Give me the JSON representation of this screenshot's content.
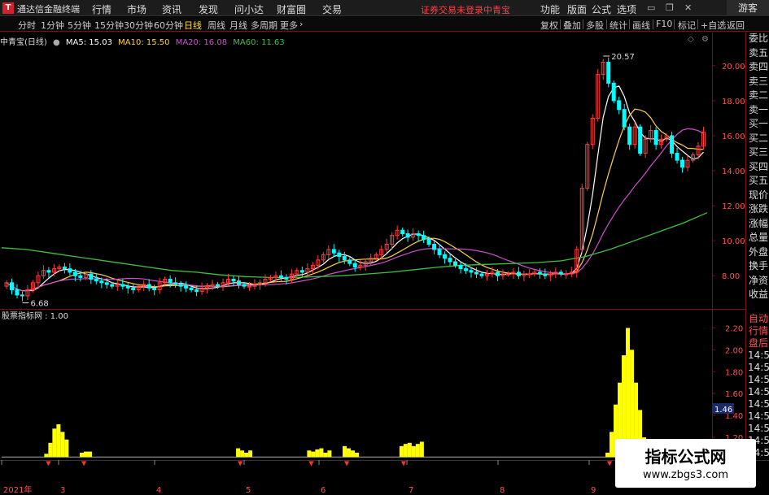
{
  "app": {
    "logo": "T",
    "title": "通达信金融终端"
  },
  "menu": [
    "行情",
    "市场",
    "资讯",
    "发现",
    "问小达",
    "财富圈",
    "交易"
  ],
  "notice": {
    "status": "证券交易未登录",
    "stock": "中青宝"
  },
  "right_menu": [
    "功能",
    "版面",
    "公式",
    "选项"
  ],
  "guest": "游客",
  "periods": [
    {
      "label": "分时",
      "active": false
    },
    {
      "label": "1分钟",
      "active": false
    },
    {
      "label": "5分钟",
      "active": false
    },
    {
      "label": "15分钟",
      "active": false
    },
    {
      "label": "30分钟",
      "active": false
    },
    {
      "label": "60分钟",
      "active": false
    },
    {
      "label": "日线",
      "active": true
    },
    {
      "label": "周线",
      "active": false
    },
    {
      "label": "月线",
      "active": false
    },
    {
      "label": "多周期",
      "active": false
    },
    {
      "label": "更多",
      "active": false
    }
  ],
  "tools": [
    "复权",
    "叠加",
    "多股",
    "统计",
    "画线",
    "F10",
    "标记",
    "+自选",
    "返回"
  ],
  "legend": {
    "stock": "中青宝(日线)",
    "ma": [
      {
        "label": "MA5: 15.03",
        "color": "#ffffff"
      },
      {
        "label": "MA10: 15.50",
        "color": "#ffd24a"
      },
      {
        "label": "MA20: 16.08",
        "color": "#d050d0"
      },
      {
        "label": "MA60: 11.63",
        "color": "#40c040"
      }
    ]
  },
  "sub_legend": "股票指标网 : 1.00",
  "right_panel_top": [
    "委比",
    "卖五",
    "卖四",
    "卖三",
    "卖二",
    "卖一",
    "买一",
    "买二",
    "买三",
    "买四",
    "买五",
    "现价",
    "涨跌",
    "涨幅",
    "总量",
    "外盘",
    "换手",
    "净资",
    "收益"
  ],
  "right_panel_bottom": [
    "自动",
    "行情",
    "盘后",
    "14:56",
    "14:56",
    "14:56",
    "14:56",
    "14:56",
    "14:56",
    "14:56",
    "14:56",
    "14:56"
  ],
  "watermark": {
    "line1": "指标公式网",
    "line2": "www.zbgs3.com"
  },
  "colors": {
    "up": "#ff3c3c",
    "down": "#00ffff",
    "indicator": "#ffff00",
    "grid": "#7a1010"
  },
  "chart_data": [
    {
      "type": "candlestick",
      "title": "中青宝(日线)",
      "y_axis_ticks": [
        "20.00",
        "18.00",
        "16.00",
        "14.00",
        "12.00",
        "10.00",
        "8.00"
      ],
      "ylim": [
        6.2,
        21.2
      ],
      "annotations": [
        {
          "label": "20.57",
          "note": "period high"
        },
        {
          "label": "6.68",
          "note": "period low"
        }
      ],
      "x_ticks": [
        "2021年",
        "3",
        "4",
        "5",
        "6",
        "7",
        "8",
        "9"
      ],
      "close_series": [
        7.6,
        7.2,
        6.9,
        6.85,
        7.2,
        7.6,
        8.0,
        8.3,
        8.2,
        8.4,
        8.5,
        8.4,
        8.2,
        8.0,
        7.9,
        8.1,
        7.8,
        7.7,
        7.6,
        7.5,
        7.4,
        7.5,
        7.4,
        7.3,
        7.2,
        7.4,
        7.5,
        7.3,
        7.2,
        7.6,
        7.8,
        7.6,
        7.5,
        7.4,
        7.3,
        7.2,
        7.1,
        7.3,
        7.4,
        7.5,
        7.4,
        7.6,
        7.8,
        7.7,
        7.5,
        7.4,
        7.4,
        7.5,
        7.6,
        7.8,
        7.9,
        8.0,
        7.9,
        7.8,
        8.1,
        8.3,
        8.2,
        8.4,
        8.6,
        8.9,
        9.2,
        9.5,
        9.3,
        9.1,
        8.9,
        8.7,
        8.5,
        8.6,
        8.8,
        9.0,
        9.2,
        9.5,
        9.8,
        10.3,
        10.6,
        10.4,
        10.2,
        10.4,
        10.3,
        10.1,
        9.8,
        9.5,
        9.2,
        9.0,
        8.8,
        8.6,
        8.4,
        8.3,
        8.2,
        8.1,
        8.0,
        8.1,
        8.2,
        8.0,
        8.1,
        8.1,
        8.2,
        8.0,
        8.1,
        8.1,
        8.2,
        8.1,
        8.0,
        8.1,
        8.2,
        8.1,
        8.1,
        8.2,
        9.5,
        13.0,
        15.5,
        17.0,
        19.5,
        20.2,
        19.0,
        18.0,
        17.5,
        16.5,
        15.5,
        16.5,
        15.0,
        15.8,
        16.3,
        15.5,
        15.8,
        16.0,
        15.0,
        14.6,
        14.2,
        14.6,
        14.9,
        15.4,
        16.2
      ],
      "ma60_series": [
        9.6,
        9.5,
        9.3,
        9.1,
        8.9,
        8.7,
        8.5,
        8.3,
        8.2,
        8.05,
        7.95,
        7.9,
        7.9,
        7.95,
        8.0,
        8.1,
        8.2,
        8.35,
        8.5,
        8.6,
        8.65,
        8.7,
        8.75,
        8.85,
        9.1,
        9.5,
        10.0,
        10.5,
        11.0,
        11.6
      ],
      "y_unit": "price",
      "notes": "Daily K-line with MA5/MA10/MA20/MA60 overlays; price surges from ~8 to 20.57 in late Aug/Sep."
    },
    {
      "type": "bar",
      "title": "股票指标网",
      "y_axis_ticks": [
        "2.20",
        "2.00",
        "1.80",
        "1.60",
        "1.40",
        "1.20"
      ],
      "current_value_label": "1.46",
      "ylim": [
        1.0,
        2.3
      ],
      "bar_groups": [
        {
          "start": 0.06,
          "values": [
            1.05,
            1.15,
            1.28,
            1.32,
            1.25,
            1.18
          ]
        },
        {
          "start": 0.11,
          "values": [
            1.06,
            1.07,
            1.07
          ]
        },
        {
          "start": 0.33,
          "values": [
            1.1,
            1.08,
            1.06,
            1.08
          ]
        },
        {
          "start": 0.43,
          "values": [
            1.08,
            1.07,
            1.09,
            1.1,
            1.06,
            1.08
          ]
        },
        {
          "start": 0.48,
          "values": [
            1.12,
            1.1,
            1.08,
            1.06
          ]
        },
        {
          "start": 0.56,
          "values": [
            1.12,
            1.14,
            1.15,
            1.12,
            1.14,
            1.16
          ]
        },
        {
          "start": 0.85,
          "values": [
            1.06,
            1.25,
            1.5,
            1.7,
            1.95,
            2.2,
            2.0,
            1.7,
            1.45,
            1.2
          ]
        }
      ]
    }
  ]
}
